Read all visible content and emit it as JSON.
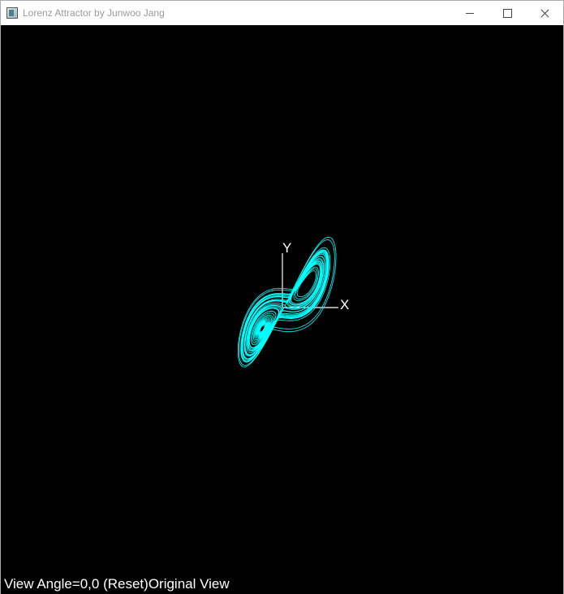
{
  "window": {
    "title": "Lorenz Attractor by Junwoo Jang"
  },
  "scene": {
    "curve_color": "#00ffff",
    "axis_color": "#ffffff",
    "axes": {
      "x_label": "X",
      "y_label": "Y"
    }
  },
  "status": {
    "text": "View Angle=0,0 (Reset)Original View"
  }
}
